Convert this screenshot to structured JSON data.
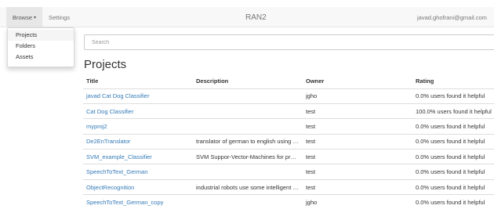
{
  "navbar": {
    "browse_label": "Browse",
    "caret": "▾",
    "settings_label": "Settings",
    "brand": "RAN2",
    "user_email": "javad.ghofrani@gmail.com"
  },
  "browse_menu": {
    "items": [
      {
        "label": "Projects",
        "active": true
      },
      {
        "label": "Folders",
        "active": false
      },
      {
        "label": "Assets",
        "active": false
      }
    ]
  },
  "search": {
    "placeholder": "Search",
    "value": ""
  },
  "main": {
    "title": "Projects",
    "table": {
      "columns": [
        "Title",
        "Description",
        "Owner",
        "Rating"
      ],
      "rows": [
        {
          "title": "javad Cat Dog Classifier",
          "description": "",
          "owner": "jgho",
          "rating": "0.0% users found it helpful"
        },
        {
          "title": "Cat Dog Classifier",
          "description": "",
          "owner": "test",
          "rating": "100.0% users found it helpful"
        },
        {
          "title": "myproj2",
          "description": "",
          "owner": "test",
          "rating": "0.0% users found it helpful"
        },
        {
          "title": "De2EnTranslator",
          "description": "translator of german to english using …",
          "owner": "test",
          "rating": "0.0% users found it helpful"
        },
        {
          "title": "SVM_example_Classifier",
          "description": "SVM Suppor-Vector-Machines for pre…",
          "owner": "test",
          "rating": "0.0% users found it helpful"
        },
        {
          "title": "SpeechToText_German",
          "description": "",
          "owner": "test",
          "rating": "0.0% users found it helpful"
        },
        {
          "title": "ObjectRecognition",
          "description": "industrial robots use some intelligent …",
          "owner": "test",
          "rating": "0.0% users found it helpful"
        },
        {
          "title": "SpeechToText_German_copy",
          "description": "",
          "owner": "jgho",
          "rating": "0.0% users found it helpful"
        }
      ]
    }
  },
  "colors": {
    "link": "#337ab7",
    "navbar_bg": "#f8f8f8",
    "active_nav_bg": "#e7e7e7",
    "border": "#dddddd"
  }
}
